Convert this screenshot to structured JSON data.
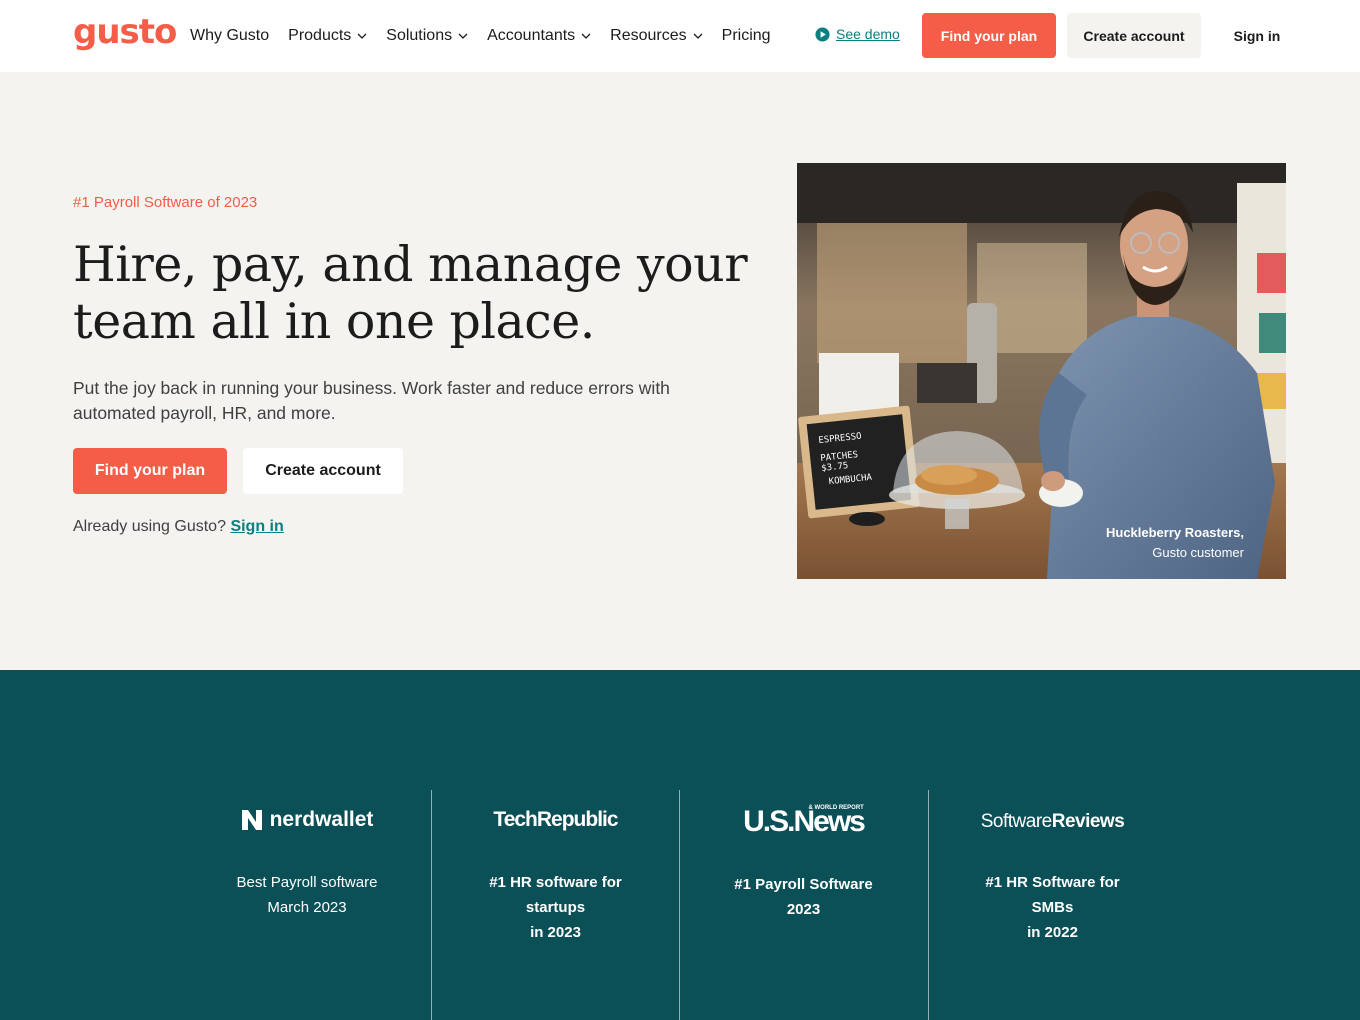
{
  "header": {
    "logo": "gusto",
    "nav": [
      {
        "label": "Why Gusto",
        "dropdown": false
      },
      {
        "label": "Products",
        "dropdown": true
      },
      {
        "label": "Solutions",
        "dropdown": true
      },
      {
        "label": "Accountants",
        "dropdown": true
      },
      {
        "label": "Resources",
        "dropdown": true
      },
      {
        "label": "Pricing",
        "dropdown": false
      }
    ],
    "demo_label": "See demo",
    "find_plan": "Find your plan",
    "create_account": "Create account",
    "sign_in": "Sign in"
  },
  "hero": {
    "eyebrow": "#1 Payroll Software of 2023",
    "headline": "Hire, pay, and manage your team all in one place.",
    "subtext": "Put the joy back in running your business. Work faster and reduce errors with automated payroll, HR, and more.",
    "find_plan": "Find your plan",
    "create_account": "Create account",
    "already": "Already using Gusto?",
    "sign_in": "Sign in"
  },
  "photo": {
    "caption_name": "Huckleberry Roasters,",
    "caption_role": "Gusto customer",
    "letterboard": [
      "ESPRESSO",
      "PATCHES",
      "$3.75",
      "KOMBUCHA"
    ]
  },
  "awards": [
    {
      "brand": "nerdwallet",
      "text_lines": [
        "Best Payroll software",
        "March 2023"
      ]
    },
    {
      "brand": "TechRepublic",
      "text_lines": [
        "#1 HR software for",
        "startups",
        "in 2023"
      ]
    },
    {
      "brand": "U.S.News",
      "brand_small": "& WORLD REPORT",
      "text_lines": [
        "#1 Payroll Software",
        "2023"
      ]
    },
    {
      "brand_light": "Software",
      "brand_bold": "Reviews",
      "text_lines": [
        "#1 HR Software for",
        "SMBs",
        "in 2022"
      ]
    }
  ],
  "colors": {
    "brand_coral": "#f45d48",
    "teal_link": "#0a8080",
    "band_teal": "#0b4f57",
    "hero_bg": "#f4f3f0"
  }
}
